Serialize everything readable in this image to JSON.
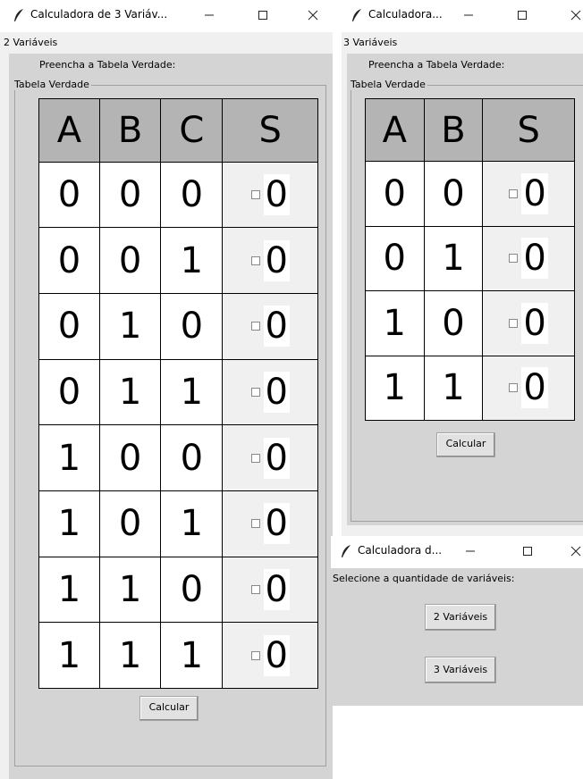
{
  "window1": {
    "title": "Calculadora de 3 Variáv...",
    "menu_label": "2 Variáveis",
    "prompt": "Preencha a Tabela Verdade:",
    "legend": "Tabela Verdade",
    "headers": [
      "A",
      "B",
      "C",
      "S"
    ],
    "rows": [
      [
        "0",
        "0",
        "0",
        "0"
      ],
      [
        "0",
        "0",
        "1",
        "0"
      ],
      [
        "0",
        "1",
        "0",
        "0"
      ],
      [
        "0",
        "1",
        "1",
        "0"
      ],
      [
        "1",
        "0",
        "0",
        "0"
      ],
      [
        "1",
        "0",
        "1",
        "0"
      ],
      [
        "1",
        "1",
        "0",
        "0"
      ],
      [
        "1",
        "1",
        "1",
        "0"
      ]
    ],
    "button": "Calcular"
  },
  "window2": {
    "title": "Calculadora...",
    "menu_label": "3 Variáveis",
    "prompt": "Preencha a Tabela Verdade:",
    "legend": "Tabela Verdade",
    "headers": [
      "A",
      "B",
      "S"
    ],
    "rows": [
      [
        "0",
        "0",
        "0"
      ],
      [
        "0",
        "1",
        "0"
      ],
      [
        "1",
        "0",
        "0"
      ],
      [
        "1",
        "1",
        "0"
      ]
    ],
    "button": "Calcular"
  },
  "window3": {
    "title": "Calculadora d...",
    "prompt": "Selecione a quantidade de variáveis:",
    "button_2": "2 Variáveis",
    "button_3": "3 Variáveis"
  },
  "icons": {
    "app": "feather-icon",
    "minimize": "minimize-icon",
    "maximize": "maximize-icon",
    "close": "close-icon"
  }
}
